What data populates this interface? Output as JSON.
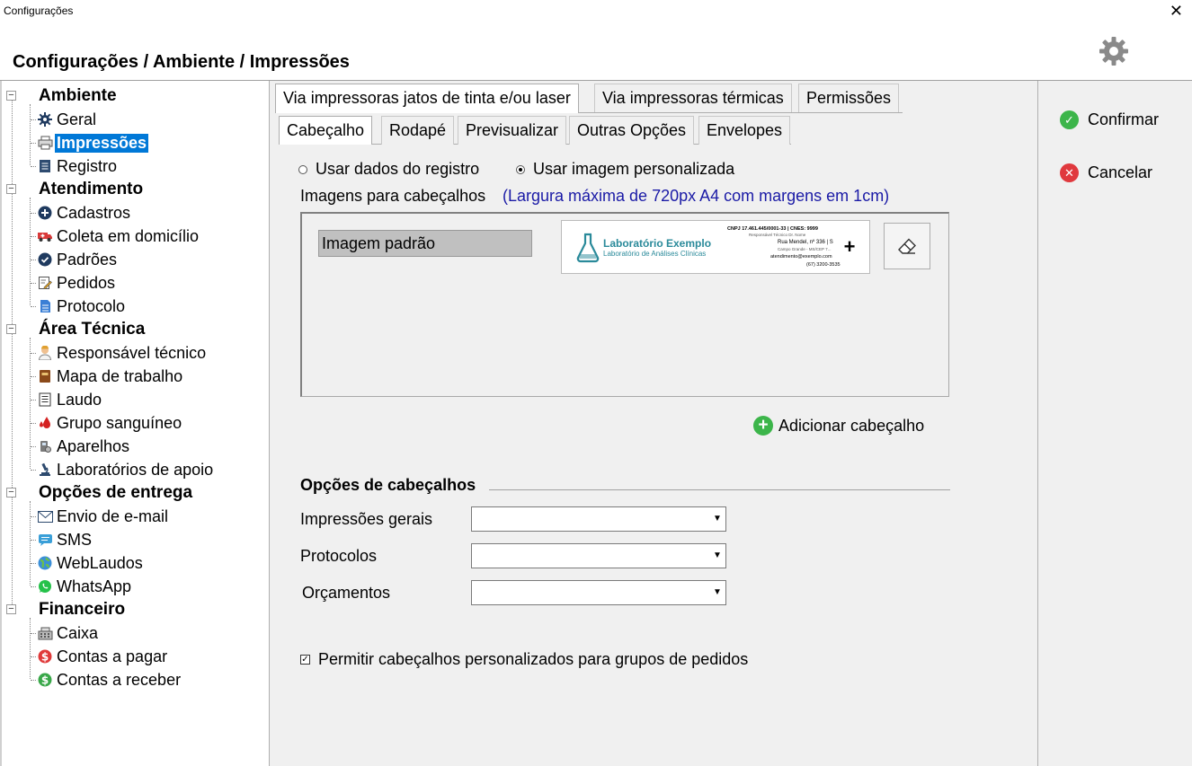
{
  "window": {
    "title": "Configurações",
    "close_glyph": "✕"
  },
  "header": {
    "breadcrumb": "Configurações / Ambiente / Impressões",
    "settings_icon": "gear-icon"
  },
  "sidebar": {
    "groups": [
      {
        "label": "Ambiente",
        "items": [
          {
            "label": "Geral",
            "icon": "gear-icon"
          },
          {
            "label": "Impressões",
            "icon": "printer-icon",
            "selected": true
          },
          {
            "label": "Registro",
            "icon": "document-icon"
          }
        ]
      },
      {
        "label": "Atendimento",
        "items": [
          {
            "label": "Cadastros",
            "icon": "plus-circle-icon"
          },
          {
            "label": "Coleta em domicílio",
            "icon": "ambulance-icon"
          },
          {
            "label": "Padrões",
            "icon": "check-circle-icon"
          },
          {
            "label": "Pedidos",
            "icon": "edit-icon"
          },
          {
            "label": "Protocolo",
            "icon": "page-icon"
          }
        ]
      },
      {
        "label": "Área Técnica",
        "items": [
          {
            "label": "Responsável técnico",
            "icon": "person-icon"
          },
          {
            "label": "Mapa de trabalho",
            "icon": "book-icon"
          },
          {
            "label": "Laudo",
            "icon": "report-icon"
          },
          {
            "label": "Grupo sanguíneo",
            "icon": "blood-drop-icon"
          },
          {
            "label": "Aparelhos",
            "icon": "device-icon"
          },
          {
            "label": "Laboratórios de apoio",
            "icon": "microscope-icon"
          }
        ]
      },
      {
        "label": "Opções de entrega",
        "items": [
          {
            "label": "Envio de e-mail",
            "icon": "envelope-icon"
          },
          {
            "label": "SMS",
            "icon": "sms-icon"
          },
          {
            "label": "WebLaudos",
            "icon": "globe-icon"
          },
          {
            "label": "WhatsApp",
            "icon": "whatsapp-icon"
          }
        ]
      },
      {
        "label": "Financeiro",
        "items": [
          {
            "label": "Caixa",
            "icon": "cash-register-icon"
          },
          {
            "label": "Contas a pagar",
            "icon": "money-out-icon"
          },
          {
            "label": "Contas a receber",
            "icon": "money-in-icon"
          }
        ]
      }
    ]
  },
  "tabs_top": [
    "Via impressoras jatos de tinta e/ou laser",
    "Via impressoras térmicas",
    "Permissões"
  ],
  "tabs_sub": [
    "Cabeçalho",
    "Rodapé",
    "Previsualizar",
    "Outras Opções",
    "Envelopes"
  ],
  "source": {
    "option_registry": "Usar dados do registro",
    "option_custom": "Usar imagem personalizada",
    "selected": "option_custom"
  },
  "images": {
    "label": "Imagens para cabeçalhos",
    "hint": "(Largura máxima de 720px A4 com margens em 1cm)",
    "items": [
      {
        "name": "Imagem padrão",
        "preview": {
          "lab_name": "Laboratório Exemplo",
          "lab_subtitle": "Laboratório de Análises Clínicas",
          "cnpj_line": "CNPJ 17.461.445/0001-33 | CNES: 9999",
          "resp_line": "Responsável Técnico Dr. Nome",
          "address_line": "Rua Mendel, nº 336 | S",
          "city_line": "Campo Grande - MS/CEP 7...",
          "email_line": "atendimento@exemplo.com",
          "phone_line": "(67) 3200-3535"
        }
      }
    ]
  },
  "add_header": "Adicionar cabeçalho",
  "options": {
    "title": "Opções de cabeçalhos",
    "fields": [
      {
        "label": "Impressões gerais",
        "value": ""
      },
      {
        "label": "Protocolos",
        "value": ""
      },
      {
        "label": "Orçamentos",
        "value": ""
      }
    ]
  },
  "allow_custom": {
    "label": "Permitir cabeçalhos personalizados para grupos de pedidos",
    "checked": true
  },
  "actions": {
    "confirm": "Confirmar",
    "cancel": "Cancelar"
  },
  "colors": {
    "selection": "#0078d7",
    "confirm": "#3cb54a",
    "cancel": "#e0393e",
    "hint": "#1a1aa6",
    "logo_teal": "#2a8a9a"
  }
}
